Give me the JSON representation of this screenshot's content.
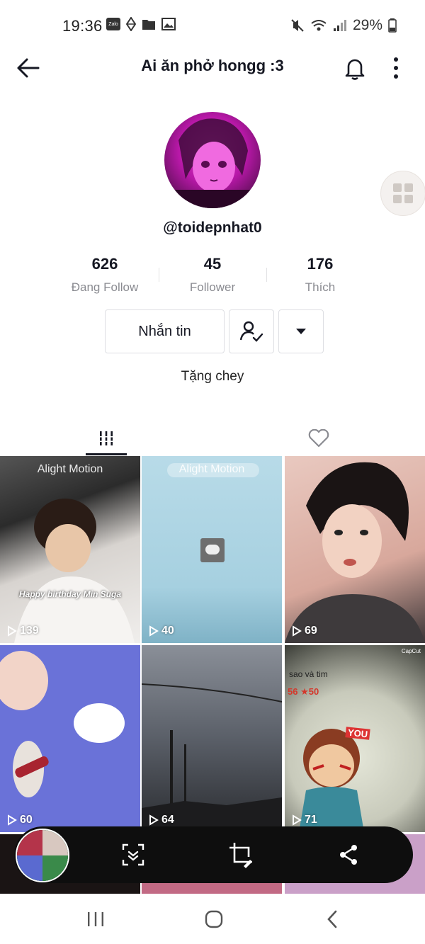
{
  "status_bar": {
    "time": "19:36",
    "battery": "29%",
    "zalo_label": "Zalo"
  },
  "header": {
    "title": "Ai ăn phở hongg :3"
  },
  "profile": {
    "handle": "@toidepnhat0",
    "stats": [
      {
        "value": "626",
        "label": "Đang Follow"
      },
      {
        "value": "45",
        "label": "Follower"
      },
      {
        "value": "176",
        "label": "Thích"
      }
    ],
    "message_button": "Nhắn tin",
    "bio": "Tặng chey"
  },
  "videos": [
    {
      "plays": "139",
      "watermark": "Alight Motion",
      "caption": "Happy birthday Min Suga"
    },
    {
      "plays": "40",
      "watermark": "Alight Motion",
      "caption": ""
    },
    {
      "plays": "69",
      "watermark": "",
      "caption": ""
    },
    {
      "plays": "60",
      "watermark": "",
      "caption": ""
    },
    {
      "plays": "64",
      "watermark": "",
      "caption": ""
    },
    {
      "plays": "71",
      "watermark": "",
      "caption": "sao và tim",
      "extra": "56 ★50",
      "badge": "YOU",
      "corner": "CapCut"
    }
  ],
  "icons": {
    "back": "arrow-left-icon",
    "bell": "bell-icon",
    "more": "more-vertical-icon",
    "grid": "grid-icon",
    "heart": "heart-icon",
    "play": "play-icon",
    "scan": "scan-icon",
    "crop": "crop-edit-icon",
    "share": "share-icon"
  }
}
